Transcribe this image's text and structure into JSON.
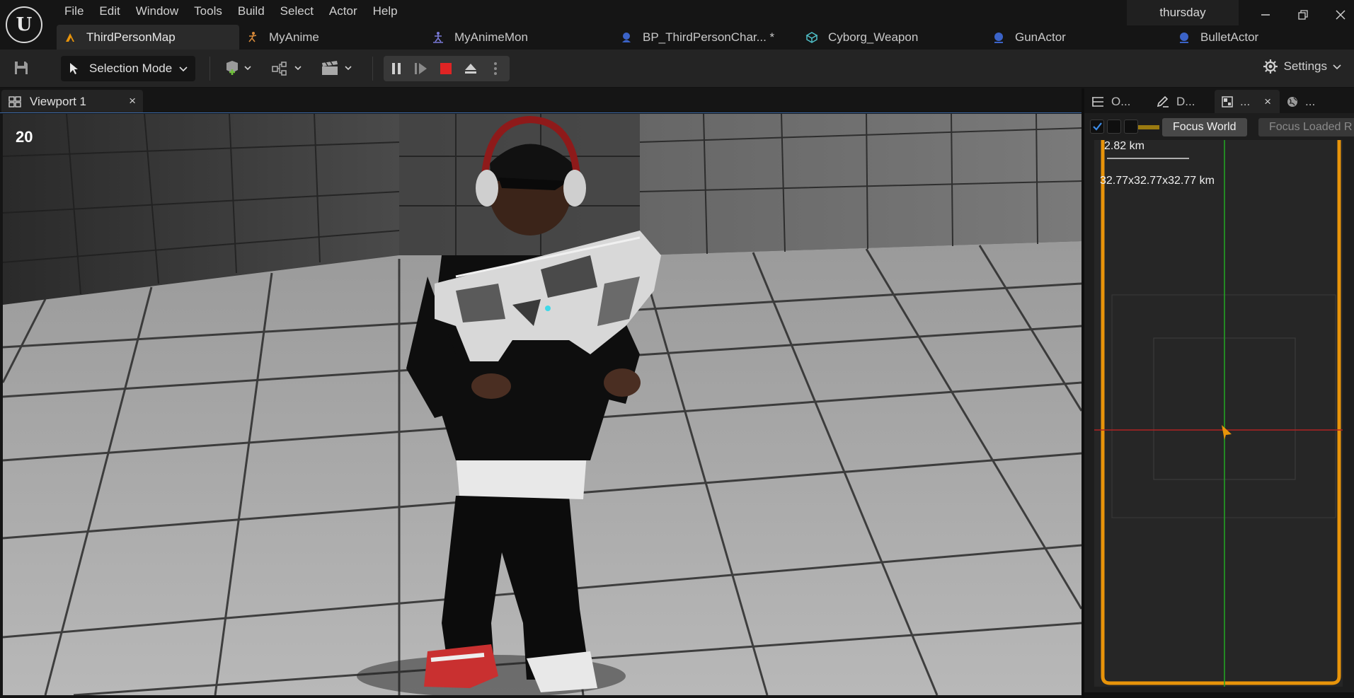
{
  "menu": [
    "File",
    "Edit",
    "Window",
    "Tools",
    "Build",
    "Select",
    "Actor",
    "Help"
  ],
  "project_name": "thursday",
  "doc_tabs": [
    {
      "label": "ThirdPersonMap",
      "icon": "level-icon"
    },
    {
      "label": "MyAnime",
      "icon": "animation-icon"
    },
    {
      "label": "MyAnimeMon",
      "icon": "anim-montage-icon"
    },
    {
      "label": "BP_ThirdPersonChar... *",
      "icon": "blueprint-icon"
    },
    {
      "label": "Cyborg_Weapon",
      "icon": "static-mesh-icon"
    },
    {
      "label": "GunActor",
      "icon": "blueprint-icon"
    },
    {
      "label": "BulletActor",
      "icon": "blueprint-icon"
    }
  ],
  "toolbar": {
    "mode_label": "Selection Mode",
    "settings_label": "Settings"
  },
  "viewport": {
    "tab_label": "Viewport 1",
    "close_glyph": "×",
    "fps": "20"
  },
  "right_panel": {
    "tabs": [
      {
        "label": "O..."
      },
      {
        "label": "D..."
      },
      {
        "label": "...",
        "close_glyph": "×"
      },
      {
        "label": "..."
      }
    ],
    "focus_world": "Focus World",
    "focus_loaded": "Focus Loaded R",
    "scale_label": "2.82 km",
    "size_label": "32.77x32.77x32.77 km"
  },
  "colors": {
    "accent_orange": "#e8940a",
    "stop_red": "#e02424",
    "selection_blue": "#3c6aa8"
  }
}
